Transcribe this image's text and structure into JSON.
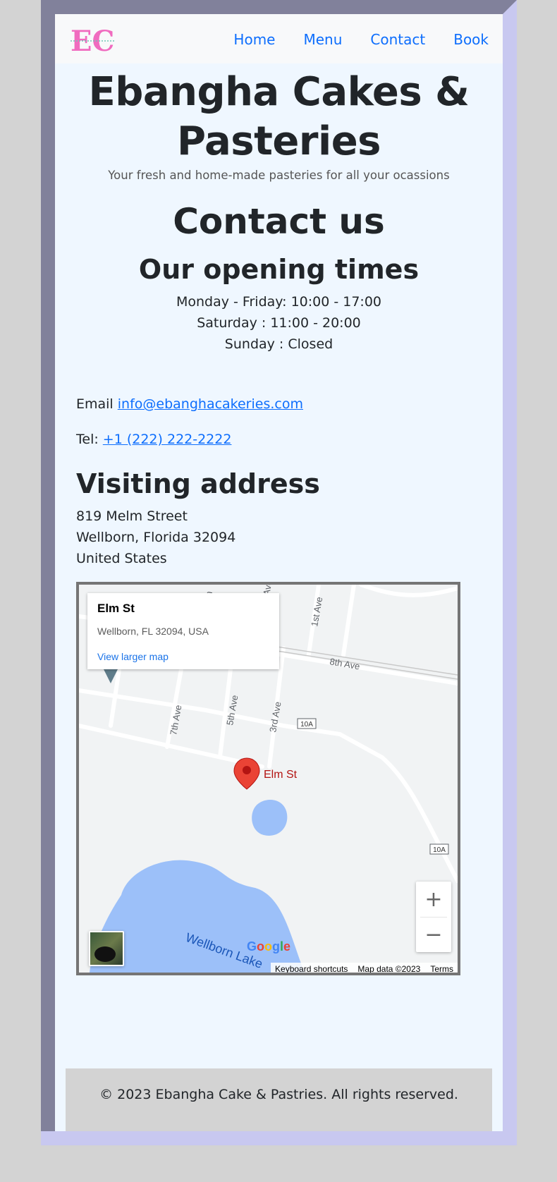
{
  "nav": {
    "logo_text": "EC",
    "logo_subtext": "EBANGHA CAKES & PASTERIES",
    "links": [
      "Home",
      "Menu",
      "Contact",
      "Book"
    ]
  },
  "header": {
    "title": "Ebangha Cakes & Pasteries",
    "tagline": "Your fresh and home-made pasteries for all your ocassions"
  },
  "contact": {
    "title": "Contact us",
    "hours_title": "Our opening times",
    "hours": [
      "Monday - Friday: 10:00 - 17:00",
      "Saturday : 11:00 - 20:00",
      "Sunday : Closed"
    ],
    "email_label": "Email",
    "email": "info@ebanghacakeries.com",
    "tel_label": "Tel:",
    "tel": "+1 (222) 222-2222"
  },
  "address": {
    "title": "Visiting address",
    "lines": [
      "819 Melm Street",
      "Wellborn, Florida 32094",
      "United States"
    ]
  },
  "map": {
    "card_title": "Elm St",
    "card_address": "Wellborn, FL 32094, USA",
    "card_link": "View larger map",
    "pin_label": "Elm St",
    "streets": [
      "7th Ave",
      "5th Ave",
      "3rd Ave",
      "1st Ave",
      "8th Ave",
      "7th",
      "Ave"
    ],
    "route_badges": [
      "10A",
      "10A"
    ],
    "lake_label": "Wellborn Lake",
    "google_letters": [
      "G",
      "o",
      "o",
      "g",
      "l",
      "e"
    ],
    "google_colors": [
      "#4285f4",
      "#ea4335",
      "#fbbc05",
      "#4285f4",
      "#34a853",
      "#ea4335"
    ],
    "zoom_in": "+",
    "zoom_out": "−",
    "attribution": [
      "Keyboard shortcuts",
      "Map data ©2023",
      "Terms"
    ]
  },
  "footer": {
    "text": "© 2023 Ebangha Cake & Pastries. All rights reserved."
  }
}
